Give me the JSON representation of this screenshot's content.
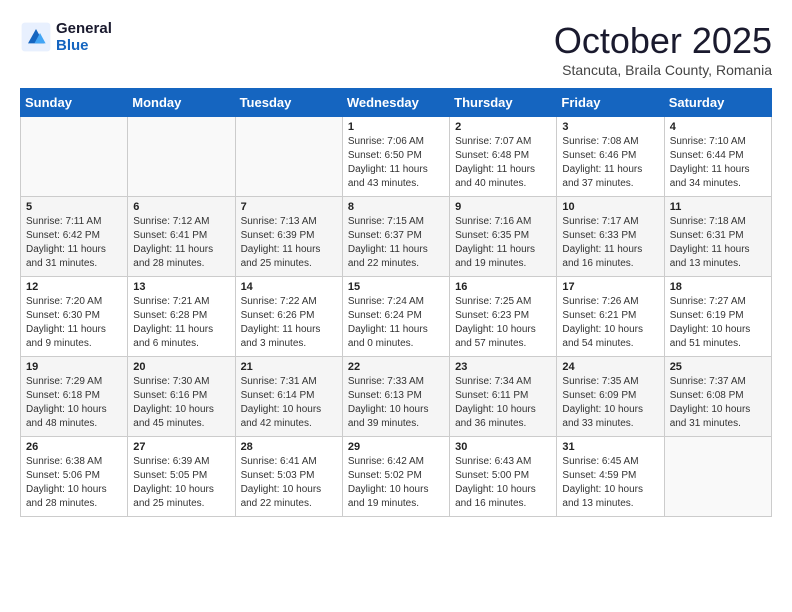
{
  "header": {
    "logo_line1": "General",
    "logo_line2": "Blue",
    "title": "October 2025",
    "subtitle": "Stancuta, Braila County, Romania"
  },
  "weekdays": [
    "Sunday",
    "Monday",
    "Tuesday",
    "Wednesday",
    "Thursday",
    "Friday",
    "Saturday"
  ],
  "weeks": [
    [
      {
        "day": "",
        "info": ""
      },
      {
        "day": "",
        "info": ""
      },
      {
        "day": "",
        "info": ""
      },
      {
        "day": "1",
        "info": "Sunrise: 7:06 AM\nSunset: 6:50 PM\nDaylight: 11 hours\nand 43 minutes."
      },
      {
        "day": "2",
        "info": "Sunrise: 7:07 AM\nSunset: 6:48 PM\nDaylight: 11 hours\nand 40 minutes."
      },
      {
        "day": "3",
        "info": "Sunrise: 7:08 AM\nSunset: 6:46 PM\nDaylight: 11 hours\nand 37 minutes."
      },
      {
        "day": "4",
        "info": "Sunrise: 7:10 AM\nSunset: 6:44 PM\nDaylight: 11 hours\nand 34 minutes."
      }
    ],
    [
      {
        "day": "5",
        "info": "Sunrise: 7:11 AM\nSunset: 6:42 PM\nDaylight: 11 hours\nand 31 minutes."
      },
      {
        "day": "6",
        "info": "Sunrise: 7:12 AM\nSunset: 6:41 PM\nDaylight: 11 hours\nand 28 minutes."
      },
      {
        "day": "7",
        "info": "Sunrise: 7:13 AM\nSunset: 6:39 PM\nDaylight: 11 hours\nand 25 minutes."
      },
      {
        "day": "8",
        "info": "Sunrise: 7:15 AM\nSunset: 6:37 PM\nDaylight: 11 hours\nand 22 minutes."
      },
      {
        "day": "9",
        "info": "Sunrise: 7:16 AM\nSunset: 6:35 PM\nDaylight: 11 hours\nand 19 minutes."
      },
      {
        "day": "10",
        "info": "Sunrise: 7:17 AM\nSunset: 6:33 PM\nDaylight: 11 hours\nand 16 minutes."
      },
      {
        "day": "11",
        "info": "Sunrise: 7:18 AM\nSunset: 6:31 PM\nDaylight: 11 hours\nand 13 minutes."
      }
    ],
    [
      {
        "day": "12",
        "info": "Sunrise: 7:20 AM\nSunset: 6:30 PM\nDaylight: 11 hours\nand 9 minutes."
      },
      {
        "day": "13",
        "info": "Sunrise: 7:21 AM\nSunset: 6:28 PM\nDaylight: 11 hours\nand 6 minutes."
      },
      {
        "day": "14",
        "info": "Sunrise: 7:22 AM\nSunset: 6:26 PM\nDaylight: 11 hours\nand 3 minutes."
      },
      {
        "day": "15",
        "info": "Sunrise: 7:24 AM\nSunset: 6:24 PM\nDaylight: 11 hours\nand 0 minutes."
      },
      {
        "day": "16",
        "info": "Sunrise: 7:25 AM\nSunset: 6:23 PM\nDaylight: 10 hours\nand 57 minutes."
      },
      {
        "day": "17",
        "info": "Sunrise: 7:26 AM\nSunset: 6:21 PM\nDaylight: 10 hours\nand 54 minutes."
      },
      {
        "day": "18",
        "info": "Sunrise: 7:27 AM\nSunset: 6:19 PM\nDaylight: 10 hours\nand 51 minutes."
      }
    ],
    [
      {
        "day": "19",
        "info": "Sunrise: 7:29 AM\nSunset: 6:18 PM\nDaylight: 10 hours\nand 48 minutes."
      },
      {
        "day": "20",
        "info": "Sunrise: 7:30 AM\nSunset: 6:16 PM\nDaylight: 10 hours\nand 45 minutes."
      },
      {
        "day": "21",
        "info": "Sunrise: 7:31 AM\nSunset: 6:14 PM\nDaylight: 10 hours\nand 42 minutes."
      },
      {
        "day": "22",
        "info": "Sunrise: 7:33 AM\nSunset: 6:13 PM\nDaylight: 10 hours\nand 39 minutes."
      },
      {
        "day": "23",
        "info": "Sunrise: 7:34 AM\nSunset: 6:11 PM\nDaylight: 10 hours\nand 36 minutes."
      },
      {
        "day": "24",
        "info": "Sunrise: 7:35 AM\nSunset: 6:09 PM\nDaylight: 10 hours\nand 33 minutes."
      },
      {
        "day": "25",
        "info": "Sunrise: 7:37 AM\nSunset: 6:08 PM\nDaylight: 10 hours\nand 31 minutes."
      }
    ],
    [
      {
        "day": "26",
        "info": "Sunrise: 6:38 AM\nSunset: 5:06 PM\nDaylight: 10 hours\nand 28 minutes."
      },
      {
        "day": "27",
        "info": "Sunrise: 6:39 AM\nSunset: 5:05 PM\nDaylight: 10 hours\nand 25 minutes."
      },
      {
        "day": "28",
        "info": "Sunrise: 6:41 AM\nSunset: 5:03 PM\nDaylight: 10 hours\nand 22 minutes."
      },
      {
        "day": "29",
        "info": "Sunrise: 6:42 AM\nSunset: 5:02 PM\nDaylight: 10 hours\nand 19 minutes."
      },
      {
        "day": "30",
        "info": "Sunrise: 6:43 AM\nSunset: 5:00 PM\nDaylight: 10 hours\nand 16 minutes."
      },
      {
        "day": "31",
        "info": "Sunrise: 6:45 AM\nSunset: 4:59 PM\nDaylight: 10 hours\nand 13 minutes."
      },
      {
        "day": "",
        "info": ""
      }
    ]
  ]
}
